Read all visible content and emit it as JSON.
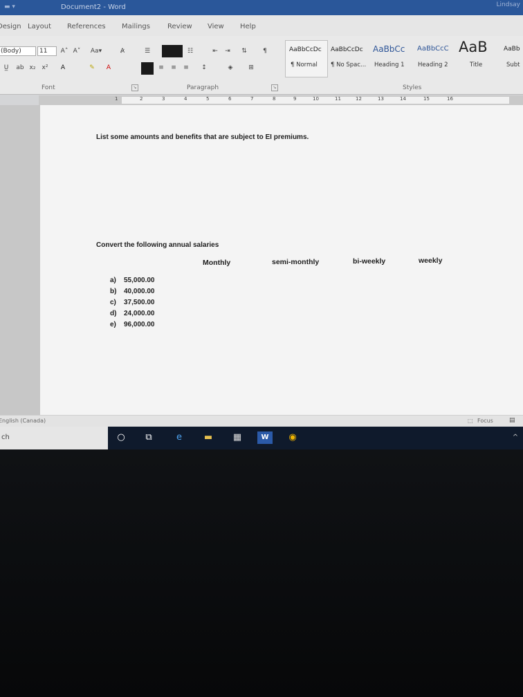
{
  "window": {
    "title": "Document2 - Word",
    "user": "Lindsay"
  },
  "tabs": [
    "Design",
    "Layout",
    "References",
    "Mailings",
    "Review",
    "View",
    "Help"
  ],
  "ribbon": {
    "font_name": "(Body)",
    "font_size": "11",
    "groups": {
      "font": "Font",
      "paragraph": "Paragraph",
      "styles": "Styles"
    },
    "styles": [
      {
        "sample": "AaBbCcDc",
        "name": "¶ Normal"
      },
      {
        "sample": "AaBbCcDc",
        "name": "¶ No Spac..."
      },
      {
        "sample": "AaBbCc",
        "name": "Heading 1"
      },
      {
        "sample": "AaBbCcC",
        "name": "Heading 2"
      },
      {
        "sample": "AaB",
        "name": "Title"
      },
      {
        "sample": "AaBb",
        "name": "Subt"
      }
    ]
  },
  "ruler": {
    "ticks": [
      "1",
      "2",
      "3",
      "4",
      "5",
      "6",
      "7",
      "8",
      "9",
      "10",
      "11",
      "12",
      "13",
      "14",
      "15",
      "16"
    ]
  },
  "document": {
    "question1": "List some amounts and benefits that are subject to EI premiums.",
    "question2": "Convert the following annual salaries",
    "columns": [
      "Monthly",
      "semi-monthly",
      "bi-weekly",
      "weekly"
    ],
    "items": [
      {
        "label": "a)",
        "amount": "55,000.00"
      },
      {
        "label": "b)",
        "amount": "40,000.00"
      },
      {
        "label": "c)",
        "amount": "37,500.00"
      },
      {
        "label": "d)",
        "amount": "24,000.00"
      },
      {
        "label": "e)",
        "amount": "96,000.00"
      }
    ]
  },
  "statusbar": {
    "language": "English (Canada)",
    "focus": "Focus"
  },
  "taskbar": {
    "search_text": "ch"
  },
  "colors": {
    "titlebar": "#2a579a",
    "taskbar": "#0f1a2c",
    "page": "#f4f4f4"
  }
}
